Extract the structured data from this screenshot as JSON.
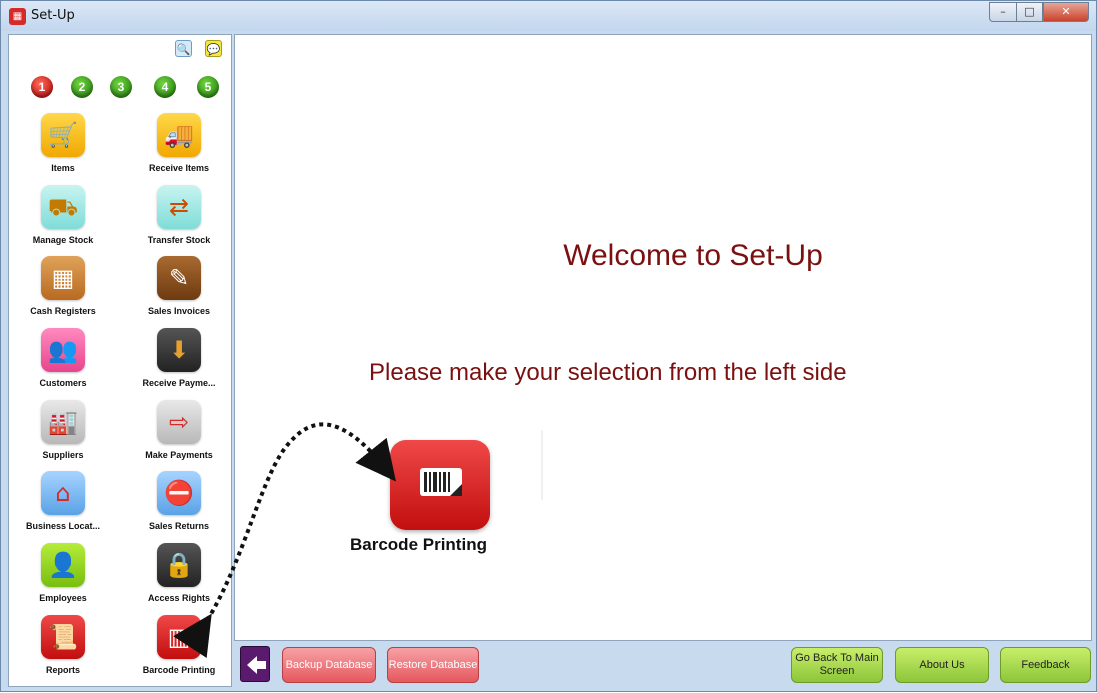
{
  "window": {
    "title": "Set-Up",
    "controls": {
      "minimize": "–",
      "maximize": "□",
      "close": "✕"
    }
  },
  "sidebar": {
    "tools": [
      {
        "icon": "search-icon",
        "glyph": "🔍"
      },
      {
        "icon": "chat-icon",
        "glyph": "💬"
      }
    ],
    "pages": [
      "1",
      "2",
      "3",
      "4",
      "5"
    ],
    "items": [
      {
        "label": "Items",
        "icon": "shopping-cart-icon",
        "glyph": "🛒"
      },
      {
        "label": "Receive Items",
        "icon": "delivery-truck-icon",
        "glyph": "🚚"
      },
      {
        "label": "Manage Stock",
        "icon": "hand-truck-icon",
        "glyph": "⛟"
      },
      {
        "label": "Transfer Stock",
        "icon": "transfer-boxes-icon",
        "glyph": "⇄"
      },
      {
        "label": "Cash Registers",
        "icon": "cash-register-icon",
        "glyph": "▦"
      },
      {
        "label": "Sales Invoices",
        "icon": "invoice-icon",
        "glyph": "✎"
      },
      {
        "label": "Customers",
        "icon": "customers-icon",
        "glyph": "👥"
      },
      {
        "label": "Receive Payme...",
        "icon": "receive-payment-icon",
        "glyph": "⬇"
      },
      {
        "label": "Suppliers",
        "icon": "factory-icon",
        "glyph": "🏭"
      },
      {
        "label": "Make Payments",
        "icon": "factory-payment-icon",
        "glyph": "⇨"
      },
      {
        "label": "Business Locat...",
        "icon": "store-icon",
        "glyph": "⌂"
      },
      {
        "label": "Sales Returns",
        "icon": "cart-return-icon",
        "glyph": "⛔"
      },
      {
        "label": "Employees",
        "icon": "employee-icon",
        "glyph": "👤"
      },
      {
        "label": "Access Rights",
        "icon": "padlock-key-icon",
        "glyph": "🔒"
      },
      {
        "label": "Reports",
        "icon": "scroll-icon",
        "glyph": "📜"
      },
      {
        "label": "Barcode Printing",
        "icon": "barcode-icon",
        "glyph": "▥"
      }
    ]
  },
  "main": {
    "welcome": "Welcome to Set-Up",
    "instruction": "Please make your selection from the left side",
    "highlight": {
      "label": "Barcode Printing",
      "icon": "barcode-printer-icon"
    }
  },
  "bottom": {
    "back": "◀",
    "backup": "Backup Database",
    "restore": "Restore Database",
    "go_back": "Go Back To Main Screen",
    "about": "About Us",
    "feedback": "Feedback"
  }
}
